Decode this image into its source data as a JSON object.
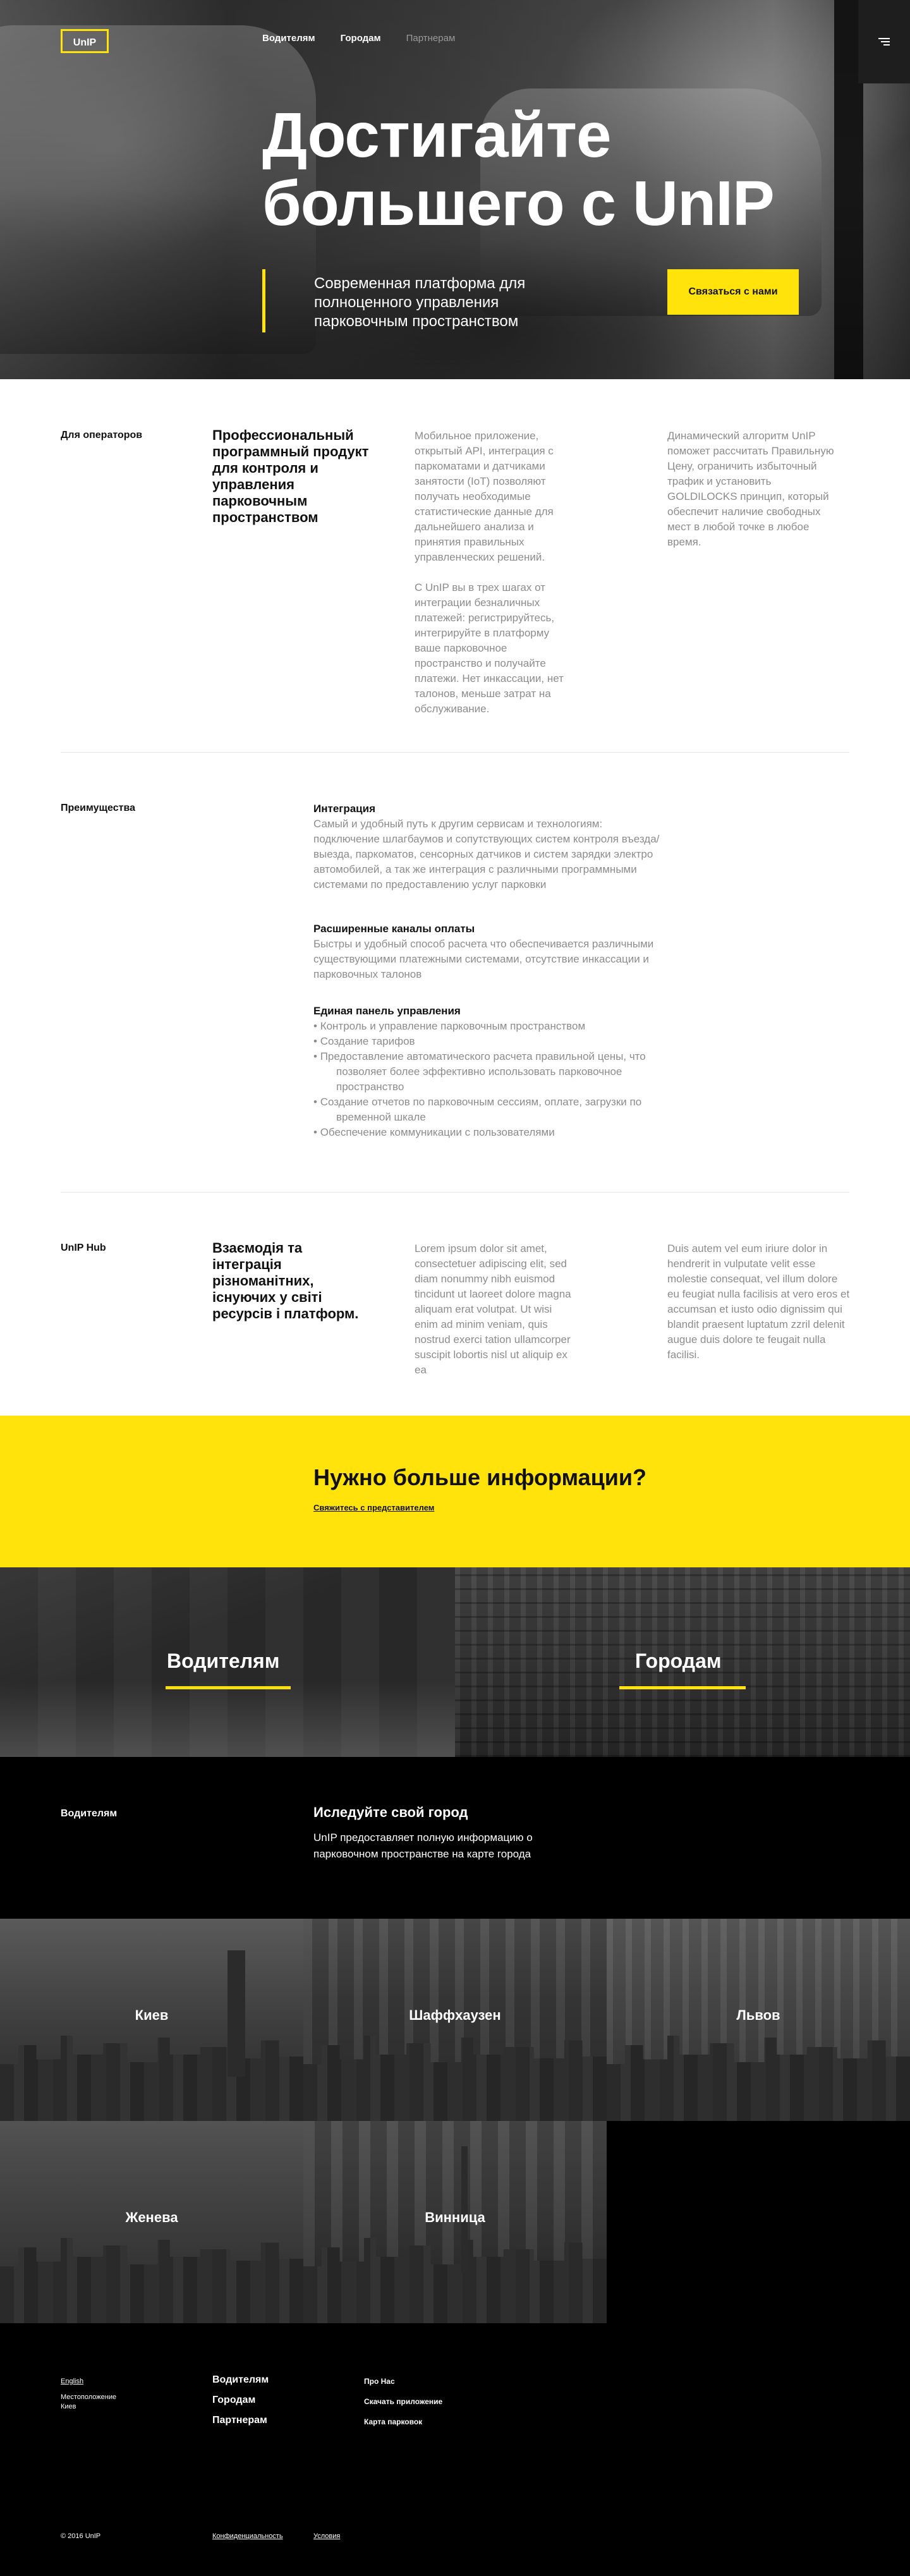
{
  "header": {
    "logo": "UnIP",
    "nav": [
      "Водителям",
      "Городам",
      "Партнерам"
    ]
  },
  "hero": {
    "title": "Достигайте большего с UnIP",
    "subtitle": "Современная платформа для полноценного управления парковочным пространством",
    "cta": "Связаться с нами"
  },
  "operators": {
    "label": "Для операторов",
    "heading": "Профессиональный программный продукт для контроля и управления парковочным пространством",
    "col1_p1": "Мобильное приложение, открытый API, интеграция с паркоматами и датчиками занятости (IoT) позволяют получать необходимые статистические данные для дальнейшего анализа и принятия правильных управленческих решений.",
    "col1_p2": "С UnIP вы в трех шагах от интеграции безналичных платежей: регистрируйтесь, интегрируйте в платформу ваше парковочное пространство и получайте платежи. Нет инкассации, нет талонов, меньше затрат на обслуживание.",
    "col2": "Динамический алгоритм UnIP поможет рассчитать Правильную Цену, ограничить избыточный трафик и установить GOLDILOCKS принцип, который обеспечит наличие свободных мест в любой точке в любое время."
  },
  "advantages": {
    "label": "Преимущества",
    "integration_title": "Интеграция",
    "integration_text": "Самый и удобный путь к другим сервисам и технологиям: подключение шлагбаумов и сопутствующих систем контроля въезда/выезда, паркоматов, сенсорных датчиков и систем зарядки электро автомобилей, а так же интеграция с различными программными системами по предоставлению услуг парковки",
    "payments_title": "Расширенные каналы оплаты",
    "payments_text": "Быстры и удобный способ расчета что обеспечивается различными существующими платежными системами, отсутствие инкассации и парковочных талонов",
    "panel_title": "Единая панель управления",
    "panel_items": [
      "Контроль и управление парковочным пространством",
      "Создание тарифов",
      "Предоставление автоматического расчета правильной цены, что позволяет более эффективно использовать парковочное пространство",
      "Создание отчетов по парковочным сессиям, оплате, загрузки по временной шкале",
      "Обеспечение коммуникации с пользователями"
    ]
  },
  "hub": {
    "label": "UnIP Hub",
    "heading": "Взаємодія та інтеграція різноманітних, існуючих у світі ресурсів і платформ.",
    "col1": "Lorem ipsum dolor sit amet, consectetuer adipiscing elit, sed diam nonummy nibh euismod tincidunt ut laoreet dolore magna aliquam erat volutpat. Ut wisi enim ad minim veniam, quis nostrud exerci tation ullamcorper suscipit lobortis nisl ut aliquip ex ea",
    "col2": "Duis autem vel eum iriure dolor in hendrerit in vulputate velit esse molestie consequat, vel illum dolore eu feugiat nulla facilisis at vero eros et accumsan et iusto odio dignissim qui blandit praesent luptatum zzril delenit augue duis dolore te feugait nulla facilisi."
  },
  "more_info": {
    "title": "Нужно больше информации?",
    "link": "Свяжитесь с представителем"
  },
  "split": {
    "drivers": "Водителям",
    "cities": "Городам"
  },
  "explore": {
    "label": "Водителям",
    "title": "Иследуйте свой город",
    "text": "UnIP предоставляет полную информацию о парковочном пространстве на карте города"
  },
  "cities": [
    "Киев",
    "Шаффхаузен",
    "Львов",
    "Женева",
    "Винница"
  ],
  "footer": {
    "language": "English",
    "location_label": "Местоположение",
    "location_value": "Киев",
    "main_links": [
      "Водителям",
      "Городам",
      "Партнерам"
    ],
    "secondary_links": [
      "Про Нас",
      "Скачать приложение",
      "Карта парковок"
    ],
    "copyright": "© 2016 UnIP",
    "privacy": "Конфиденциальность",
    "terms": "Условия"
  },
  "colors": {
    "accent": "#ffe30a",
    "dark": "#000000",
    "muted_text": "#8c8c8c"
  }
}
